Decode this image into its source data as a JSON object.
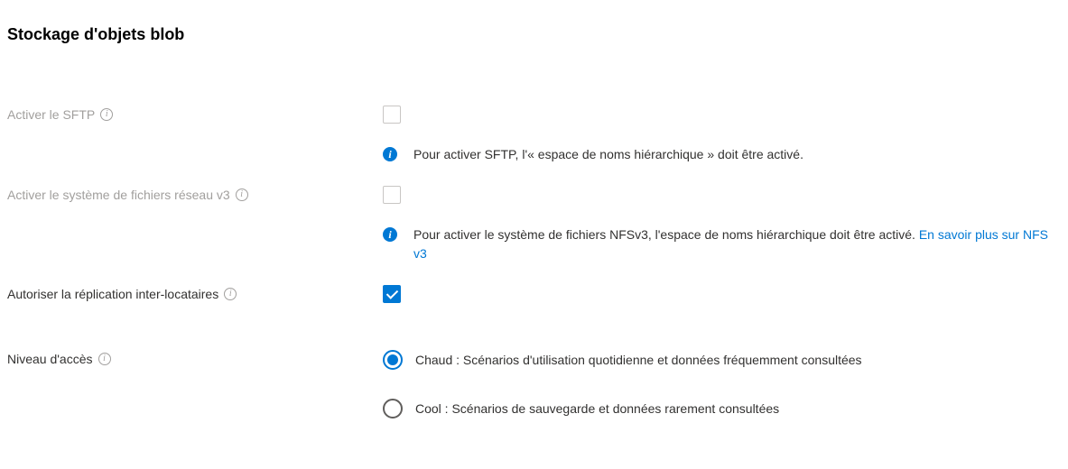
{
  "section": {
    "title": "Stockage d'objets blob"
  },
  "sftp": {
    "label": "Activer le SFTP",
    "info_text": "Pour activer SFTP, l'« espace de noms hiérarchique » doit être activé."
  },
  "nfs": {
    "label": "Activer le système de fichiers réseau v3",
    "info_text_prefix": "Pour activer le système de fichiers NFSv3, l'espace de noms hiérarchique doit être activé. ",
    "info_link": "En savoir plus sur NFS v3"
  },
  "replication": {
    "label": "Autoriser la réplication inter-locataires"
  },
  "access_tier": {
    "label": "Niveau d'accès",
    "options": [
      "Chaud : Scénarios d'utilisation quotidienne et données fréquemment consultées",
      "Cool : Scénarios de sauvegarde et données rarement consultées"
    ]
  }
}
